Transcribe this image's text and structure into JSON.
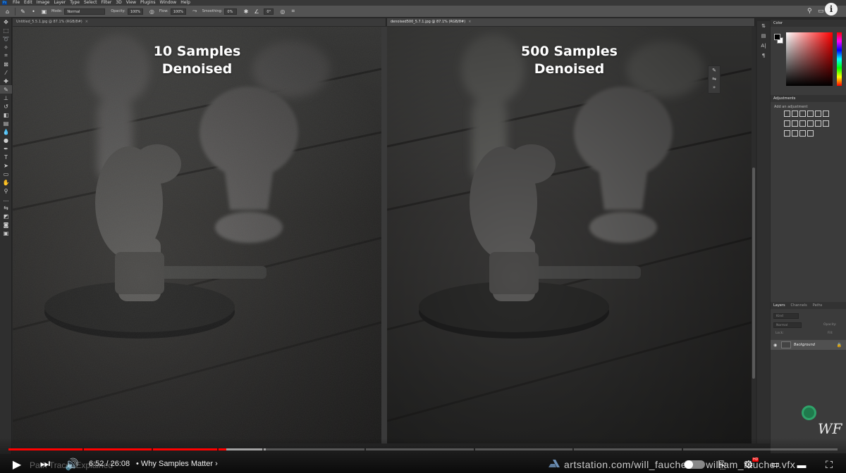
{
  "app": {
    "menu": [
      "File",
      "Edit",
      "Image",
      "Layer",
      "Type",
      "Select",
      "Filter",
      "3D",
      "View",
      "Plugins",
      "Window",
      "Help"
    ]
  },
  "options_bar": {
    "mode_label": "Mode:",
    "mode_value": "Normal",
    "opacity_label": "Opacity:",
    "opacity_value": "100%",
    "flow_label": "Flow:",
    "flow_value": "100%",
    "smoothing_label": "Smoothing:",
    "smoothing_value": "0%",
    "angle_value": "0°"
  },
  "documents": [
    {
      "tab": "Untitled_5.5.1.jpg @ 87.1% (RGB/8#)",
      "overlay_line1": "10 Samples",
      "overlay_line2": "Denoised"
    },
    {
      "tab": "denoised500_5.7.1.jpg @ 87.1% (RGB/8#)",
      "overlay_line1": "500 Samples",
      "overlay_line2": "Denoised"
    }
  ],
  "panels": {
    "color_tab": "Color",
    "adjustments_tab": "Adjustments",
    "adjustments_hint": "Add an adjustment",
    "layers_tabs": [
      "Layers",
      "Channels",
      "Paths"
    ],
    "layer_kind": "Kind",
    "layer_blend": "Normal",
    "layer_opacity_label": "Opacity:",
    "layer_lock_label": "Lock:",
    "layer_fill_label": "Fill:",
    "layer_name": "Background"
  },
  "player": {
    "current_time": "6:52",
    "duration": "26:08",
    "time_display": "6:52 / 26:08",
    "chapter": "Why Samples Matter",
    "ghost_title": "Path Tracer Explained",
    "url_text": "artstation.com/will_faucher",
    "url_text_end": "william_faucher.vfx",
    "played_fraction": 0.263,
    "buffered_fraction": 0.31,
    "hd_badge": "HD",
    "brand_mark": "WF"
  },
  "colors": {
    "accent": "#ff0000",
    "panel_bg": "#3b3b3b",
    "app_bg": "#282828"
  }
}
